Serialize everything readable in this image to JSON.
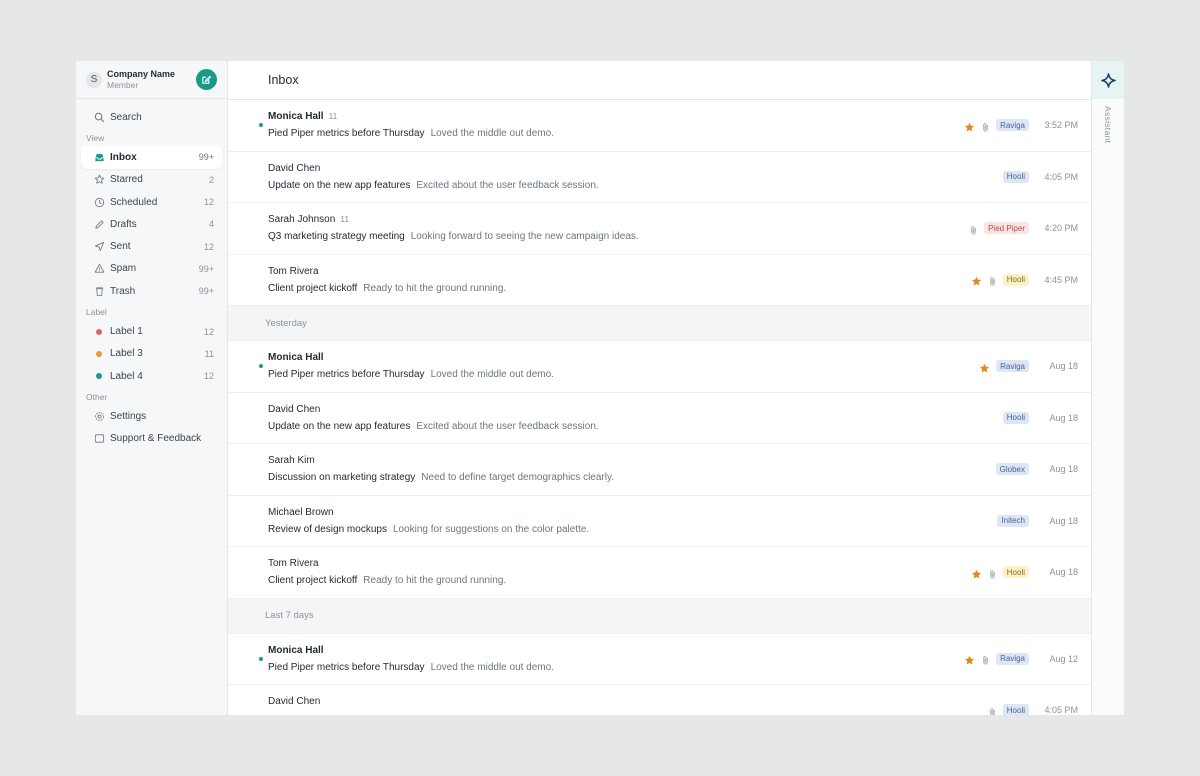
{
  "workspace": {
    "avatar_letter": "S",
    "company_name": "Company Name",
    "role": "Member"
  },
  "sidebar": {
    "search_label": "Search",
    "view_section": "View",
    "view_items": [
      {
        "label": "Inbox",
        "count": "99+",
        "icon": "inbox-icon",
        "active": true
      },
      {
        "label": "Starred",
        "count": "2",
        "icon": "star-icon"
      },
      {
        "label": "Scheduled",
        "count": "12",
        "icon": "clock-icon"
      },
      {
        "label": "Drafts",
        "count": "4",
        "icon": "pencil-icon"
      },
      {
        "label": "Sent",
        "count": "12",
        "icon": "send-icon"
      },
      {
        "label": "Spam",
        "count": "99+",
        "icon": "warning-icon"
      },
      {
        "label": "Trash",
        "count": "99+",
        "icon": "trash-icon"
      }
    ],
    "label_section": "Label",
    "label_items": [
      {
        "label": "Label 1",
        "count": "12",
        "color": "#e5606a"
      },
      {
        "label": "Label 3",
        "count": "11",
        "color": "#f0953a"
      },
      {
        "label": "Label 4",
        "count": "12",
        "color": "#1a9a8a"
      }
    ],
    "other_section": "Other",
    "other_items": [
      {
        "label": "Settings",
        "icon": "gear-icon"
      },
      {
        "label": "Support & Feedback",
        "icon": "chat-icon"
      }
    ]
  },
  "main": {
    "title": "Inbox",
    "groups": [
      {
        "header": "",
        "emails": [
          {
            "sender": "Monica Hall",
            "thread_count": "11",
            "unread": true,
            "subject": "Pied Piper metrics before Thursday",
            "preview": "Loved the middle out demo.",
            "starred": true,
            "attachment": true,
            "tag": "Raviga",
            "tag_color": "blue",
            "time": "3:52 PM"
          },
          {
            "sender": "David Chen",
            "thread_count": "",
            "unread": false,
            "subject": "Update on the new app features",
            "preview": "Excited about the user feedback session.",
            "starred": false,
            "attachment": false,
            "tag": "Hooli",
            "tag_color": "blue",
            "time": "4:05 PM"
          },
          {
            "sender": "Sarah Johnson",
            "thread_count": "11",
            "unread": false,
            "subject": "Q3 marketing strategy meeting",
            "preview": "Looking forward to seeing the new campaign ideas.",
            "starred": false,
            "attachment": true,
            "tag": "Pied Piper",
            "tag_color": "red",
            "time": "4:20 PM"
          },
          {
            "sender": "Tom Rivera",
            "thread_count": "",
            "unread": false,
            "subject": "Client project kickoff",
            "preview": "Ready to hit the ground running.",
            "starred": true,
            "attachment": true,
            "tag": "Hooli",
            "tag_color": "yellow",
            "time": "4:45 PM"
          }
        ]
      },
      {
        "header": "Yesterday",
        "emails": [
          {
            "sender": "Monica Hall",
            "thread_count": "",
            "unread": true,
            "subject": "Pied Piper metrics before Thursday",
            "preview": "Loved the middle out demo.",
            "starred": true,
            "attachment": false,
            "tag": "Raviga",
            "tag_color": "blue",
            "time": "Aug 18"
          },
          {
            "sender": "David Chen",
            "thread_count": "",
            "unread": false,
            "subject": "Update on the new app features",
            "preview": "Excited about the user feedback session.",
            "starred": false,
            "attachment": false,
            "tag": "Hooli",
            "tag_color": "blue",
            "time": "Aug 18"
          },
          {
            "sender": "Sarah Kim",
            "thread_count": "",
            "unread": false,
            "subject": "Discussion on marketing strategy",
            "preview": "Need to define target demographics clearly.",
            "starred": false,
            "attachment": false,
            "tag": "Globex",
            "tag_color": "blue",
            "time": "Aug 18"
          },
          {
            "sender": "Michael Brown",
            "thread_count": "",
            "unread": false,
            "subject": "Review of design mockups",
            "preview": "Looking for suggestions on the color palette.",
            "starred": false,
            "attachment": false,
            "tag": "Initech",
            "tag_color": "blue",
            "time": "Aug 18"
          },
          {
            "sender": "Tom Rivera",
            "thread_count": "",
            "unread": false,
            "subject": "Client project kickoff",
            "preview": "Ready to hit the ground running.",
            "starred": true,
            "attachment": true,
            "tag": "Hooli",
            "tag_color": "yellow",
            "time": "Aug 18"
          }
        ]
      },
      {
        "header": "Last 7 days",
        "emails": [
          {
            "sender": "Monica Hall",
            "thread_count": "",
            "unread": true,
            "subject": "Pied Piper metrics before Thursday",
            "preview": "Loved the middle out demo.",
            "starred": true,
            "attachment": true,
            "tag": "Raviga",
            "tag_color": "blue",
            "time": "Aug 12"
          },
          {
            "sender": "David Chen",
            "thread_count": "",
            "unread": false,
            "subject": "",
            "preview": "",
            "starred": false,
            "attachment": true,
            "tag": "Hooli",
            "tag_color": "blue",
            "time": "4:05 PM"
          }
        ]
      }
    ]
  },
  "assistant": {
    "label": "Assistant"
  },
  "colors": {
    "accent": "#1a9a8a",
    "star": "#e08a1e"
  }
}
